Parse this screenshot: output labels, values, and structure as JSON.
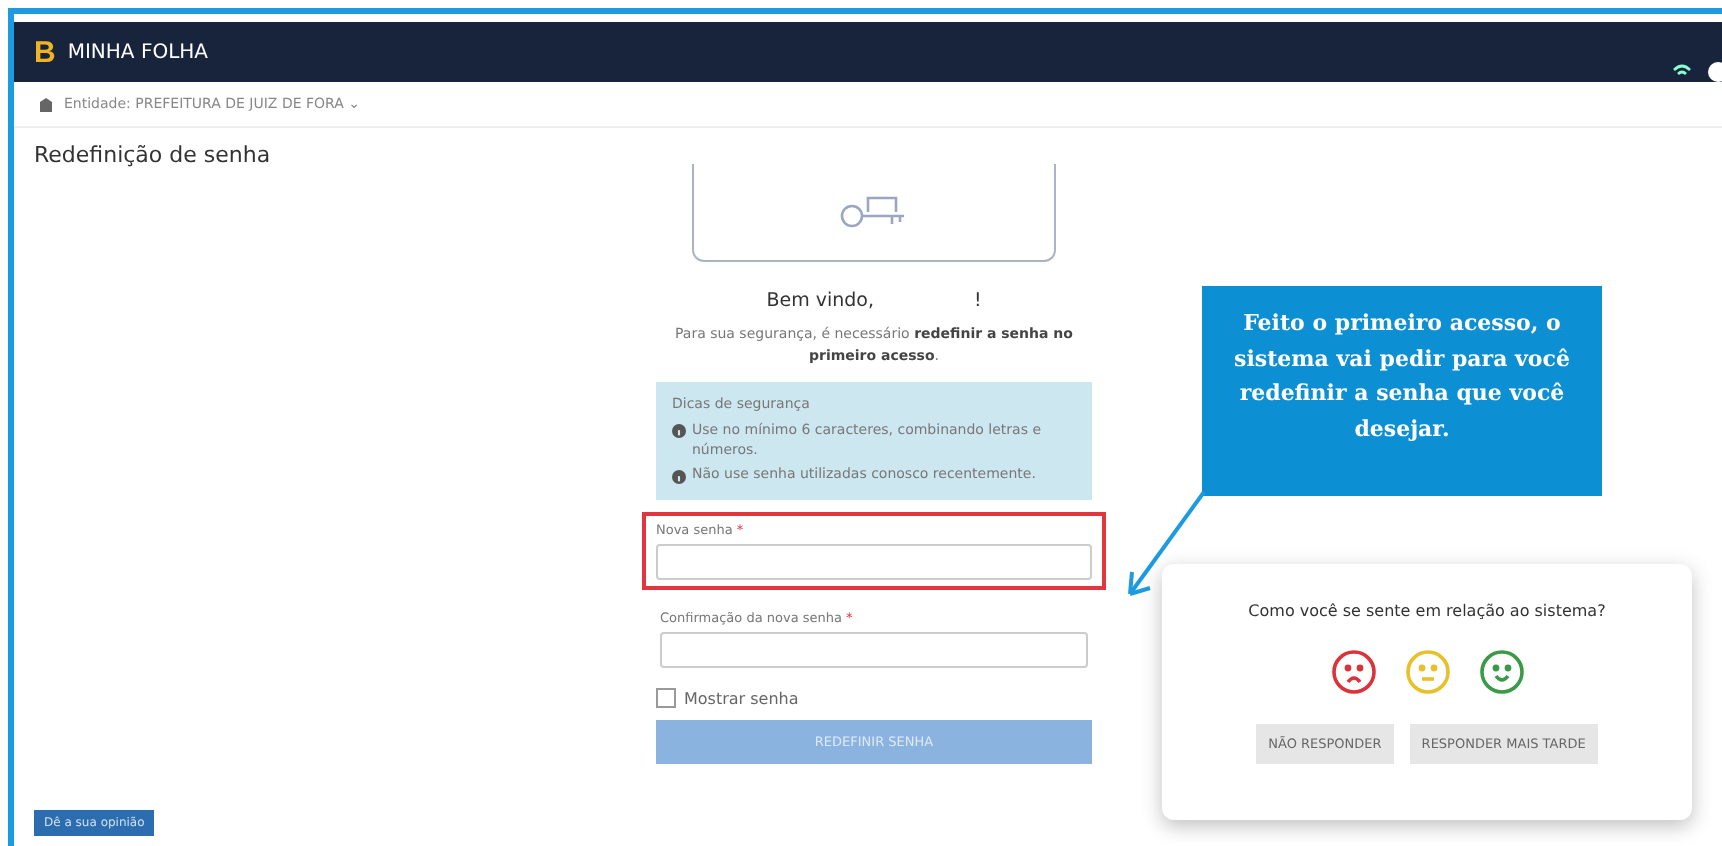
{
  "navbar": {
    "logo": "B",
    "title": "MINHA FOLHA"
  },
  "entity_bar": {
    "label": "Entidade: PREFEITURA DE JUIZ DE FORA ⌄"
  },
  "page_title": "Redefinição de senha",
  "form": {
    "greeting": "Bem vindo,",
    "greeting_end": "!",
    "intro": "Para sua segurança, é necessário **redefinir a senha no primeiro acesso**.",
    "tips": {
      "title": "Dicas de segurança",
      "items": [
        "Use no mínimo 6 caracteres, combinando letras e números.",
        "Não use senha utilizadas conosco recentemente."
      ]
    },
    "fields": [
      {
        "label": "Nova senha",
        "required_mark": "*",
        "highlighted": true
      },
      {
        "label": "Confirmação da nova senha",
        "required_mark": "*",
        "highlighted": false
      }
    ],
    "show_password": {
      "label": "Mostrar senha",
      "checked": false
    },
    "submit": "REDEFINIR SENHA"
  },
  "callout": "Feito o primeiro acesso, o sistema vai pedir para você redefinir a senha que você desejar.",
  "survey": {
    "question": "Como você se sente em relação ao sistema?",
    "faces": [
      {
        "kind": "sad",
        "color": "#d9343a"
      },
      {
        "kind": "neutral",
        "color": "#e8c02a"
      },
      {
        "kind": "happy",
        "color": "#3a9a48"
      }
    ],
    "buttons": [
      "NÃO RESPONDER",
      "RESPONDER MAIS TARDE"
    ]
  },
  "feedback_button": "Dê a sua opinião"
}
